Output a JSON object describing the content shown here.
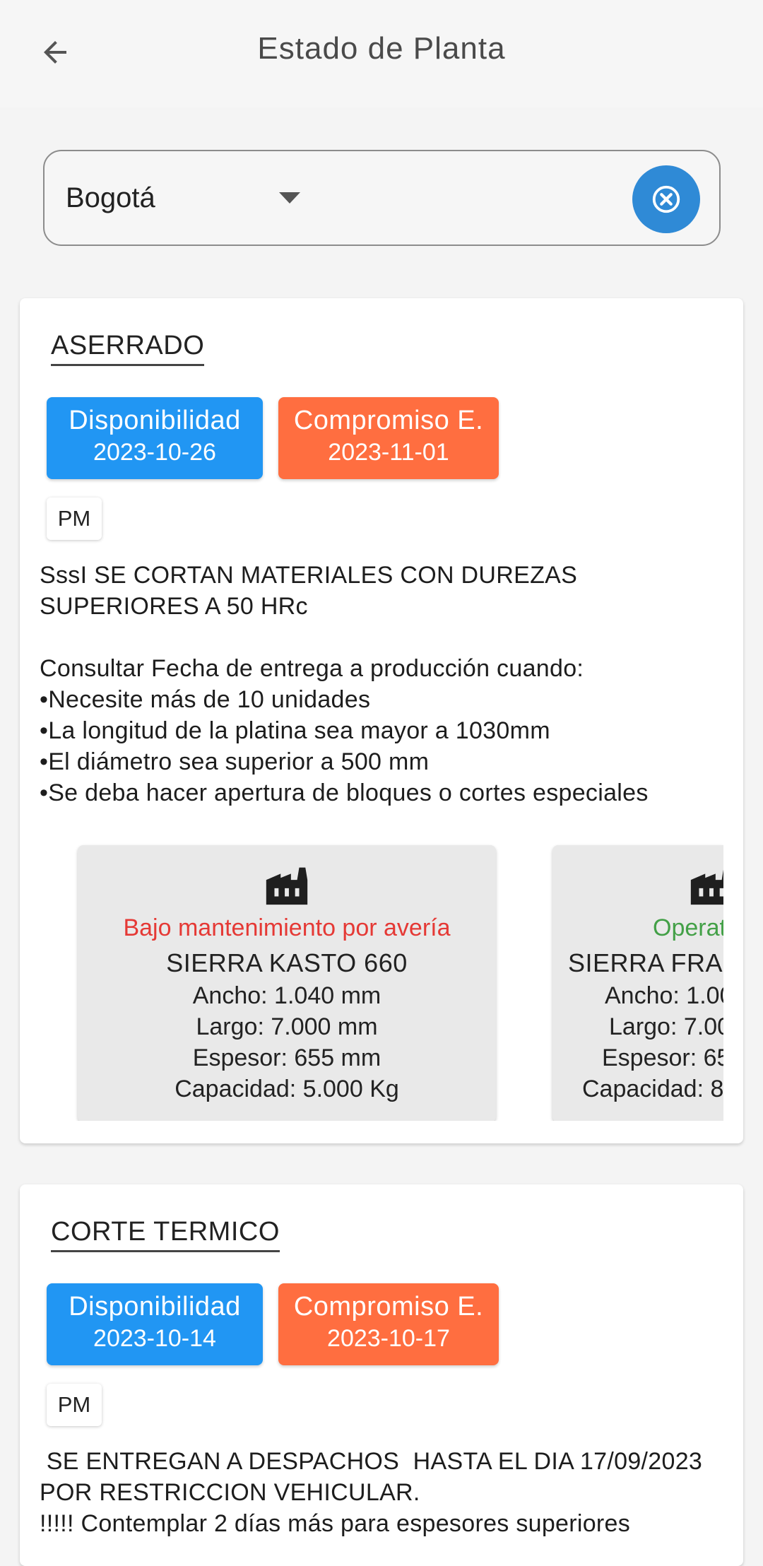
{
  "appbar": {
    "title": "Estado de Planta"
  },
  "location_select": {
    "value": "Bogotá"
  },
  "colors": {
    "availability_badge": "#2196f3",
    "commitment_badge": "#ff6e40",
    "status_maintenance": "#e53935",
    "status_operative": "#43a047",
    "clear_button": "#2f8ad6"
  },
  "sections": [
    {
      "title": "ASERRADO",
      "availability": {
        "label": "Disponibilidad",
        "date": "2023-10-26"
      },
      "commitment": {
        "label": "Compromiso E.",
        "date": "2023-11-01"
      },
      "shift": "PM",
      "notes": "SssI SE CORTAN MATERIALES CON DUREZAS\nSUPERIORES A 50 HRc\n\nConsultar Fecha de entrega a producción cuando:\n•Necesite más de 10 unidades\n•La longitud de la platina sea mayor a 1030mm\n•El diámetro sea superior a 500 mm\n•Se deba hacer apertura de bloques o cortes especiales",
      "machines": [
        {
          "icon": "factory-icon",
          "status": "Bajo mantenimiento por avería",
          "status_color": "#e53935",
          "name": "SIERRA KASTO 660",
          "width": "Ancho: 1.040 mm",
          "length": "Largo: 7.000 mm",
          "thickness": "Espesor: 655 mm",
          "capacity": "Capacidad: 5.000 Kg"
        },
        {
          "icon": "factory-icon",
          "status": "Operati",
          "status_color": "#43a047",
          "name": "SIERRA FRAN",
          "width": "Ancho: 1.00",
          "length": "Largo: 7.00",
          "thickness": "Espesor: 65",
          "capacity": "Capacidad: 8"
        }
      ]
    },
    {
      "title": "CORTE TERMICO",
      "availability": {
        "label": "Disponibilidad",
        "date": "2023-10-14"
      },
      "commitment": {
        "label": "Compromiso E.",
        "date": "2023-10-17"
      },
      "shift": "PM",
      "notes": " SE ENTREGAN A DESPACHOS  HASTA EL DIA 17/09/2023\nPOR RESTRICCION VEHICULAR.\n!!!!! Contemplar 2 días más para espesores superiores"
    }
  ]
}
